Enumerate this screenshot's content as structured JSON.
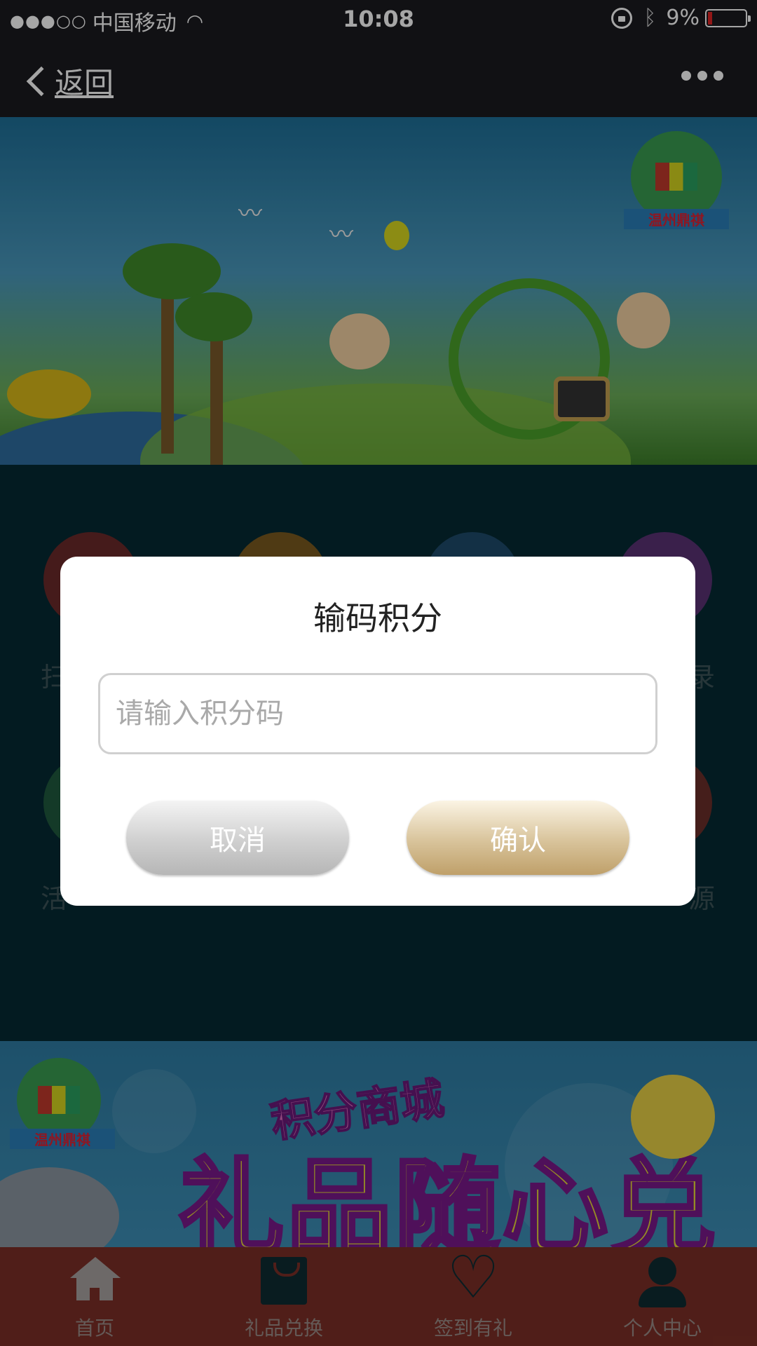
{
  "status_bar": {
    "signal": "●●●○○",
    "carrier": "中国移动",
    "time": "10:08",
    "battery_percent": "9%"
  },
  "nav": {
    "back_label": "返回"
  },
  "hero": {
    "logo_text": "温州鼎祺"
  },
  "grid": {
    "visible_fragments": [
      "扫",
      "录",
      "活",
      "源"
    ],
    "circle_colors": [
      "#b24040",
      "#b6852a",
      "#2a6e9c",
      "#8a4ca8",
      "#2e8c5a",
      "#b24a40"
    ]
  },
  "promo": {
    "logo_text": "温州鼎祺",
    "subtitle": "积分商城",
    "title": "礼品随心兑"
  },
  "tabs": [
    {
      "label": "首页",
      "icon": "home-icon"
    },
    {
      "label": "礼品兑换",
      "icon": "shopping-bag-icon"
    },
    {
      "label": "签到有礼",
      "icon": "heart-icon"
    },
    {
      "label": "个人中心",
      "icon": "person-icon"
    }
  ],
  "dialog": {
    "title": "输码积分",
    "input": {
      "placeholder": "请输入积分码",
      "value": ""
    },
    "cancel_label": "取消",
    "confirm_label": "确认"
  },
  "colors": {
    "nav_bg": "#1b1b20",
    "page_bg": "#052a33",
    "tab_bar_bg": "#7c2f27",
    "confirm_button": "#d8c39a",
    "cancel_button": "#cfcfcf"
  }
}
